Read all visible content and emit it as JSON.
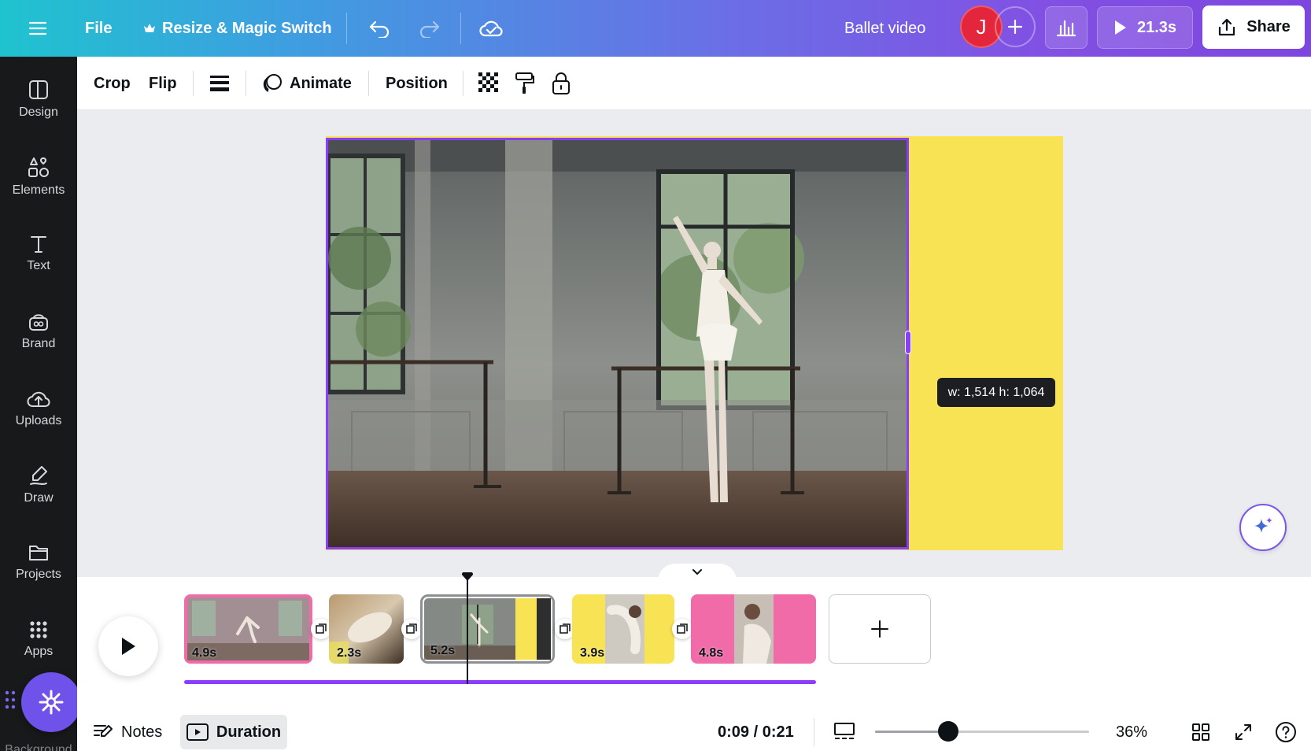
{
  "topbar": {
    "file": "File",
    "resize": "Resize & Magic Switch",
    "title": "Ballet video",
    "avatar_initial": "J",
    "play_duration": "21.3s",
    "share": "Share"
  },
  "sidebar": {
    "items": [
      {
        "label": "Design",
        "icon": "design-icon"
      },
      {
        "label": "Elements",
        "icon": "elements-icon"
      },
      {
        "label": "Text",
        "icon": "text-icon"
      },
      {
        "label": "Brand",
        "icon": "brand-icon"
      },
      {
        "label": "Uploads",
        "icon": "uploads-icon"
      },
      {
        "label": "Draw",
        "icon": "draw-icon"
      },
      {
        "label": "Projects",
        "icon": "projects-icon"
      },
      {
        "label": "Apps",
        "icon": "apps-icon"
      },
      {
        "label": "Background",
        "icon": "background-icon"
      }
    ]
  },
  "toolbar": {
    "crop": "Crop",
    "flip": "Flip",
    "animate": "Animate",
    "position": "Position"
  },
  "canvas": {
    "size_tooltip": "w: 1,514 h: 1,064",
    "colors": {
      "page": "#f8e354",
      "selection": "#8b3dff"
    }
  },
  "timeline": {
    "clips": [
      {
        "duration": "4.9s",
        "selected": false
      },
      {
        "duration": "2.3s",
        "selected": false
      },
      {
        "duration": "5.2s",
        "selected": true
      },
      {
        "duration": "3.9s",
        "selected": false
      },
      {
        "duration": "4.8s",
        "selected": false
      }
    ],
    "add_clip": "+"
  },
  "footer": {
    "notes": "Notes",
    "duration": "Duration",
    "time": "0:09 / 0:21",
    "zoom": "36%",
    "zoom_level": 0.36
  }
}
